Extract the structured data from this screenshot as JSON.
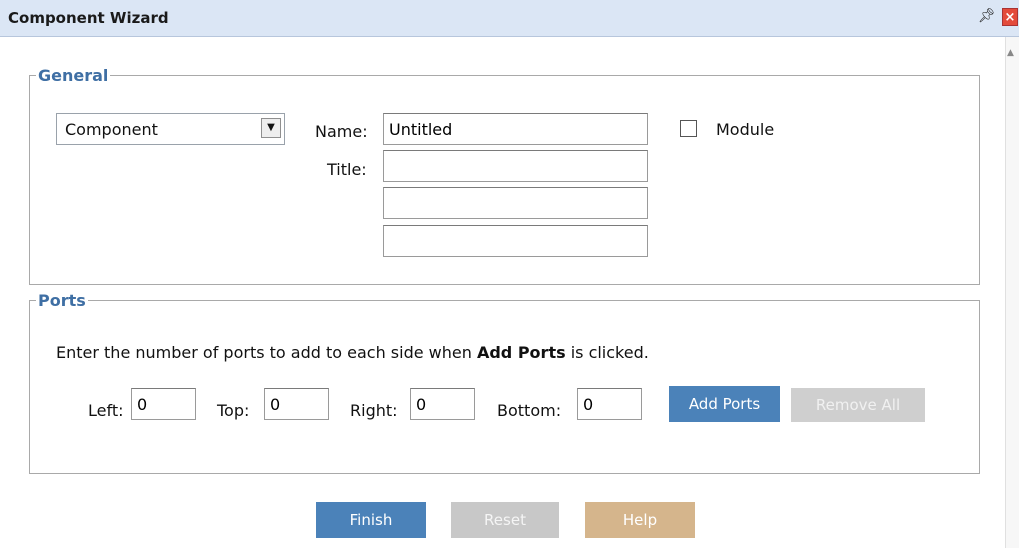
{
  "window": {
    "title": "Component Wizard",
    "pin_icon": "pin-icon",
    "close_icon": "close-icon"
  },
  "general": {
    "legend": "General",
    "type_select": {
      "value": "Component",
      "icon": "chevron-down-icon"
    },
    "name_label": "Name:",
    "name_value": "Untitled",
    "title_label": "Title:",
    "title_line1": "",
    "title_line2": "",
    "title_line3": "",
    "module_label": "Module",
    "module_checked": false
  },
  "ports": {
    "legend": "Ports",
    "instruction_prefix": "Enter the number of ports to add to each side when ",
    "instruction_bold": "Add Ports",
    "instruction_suffix": " is clicked.",
    "left_label": "Left:",
    "left_value": "0",
    "top_label": "Top:",
    "top_value": "0",
    "right_label": "Right:",
    "right_value": "0",
    "bottom_label": "Bottom:",
    "bottom_value": "0",
    "add_ports_label": "Add Ports",
    "remove_all_label": "Remove All"
  },
  "footer": {
    "finish_label": "Finish",
    "reset_label": "Reset",
    "help_label": "Help"
  },
  "colors": {
    "titlebar_bg": "#dbe6f5",
    "legend": "#3f6fa4",
    "primary_button": "#4b82b9",
    "disabled_button": "#cfcfcf",
    "help_button": "#d5b58c"
  }
}
